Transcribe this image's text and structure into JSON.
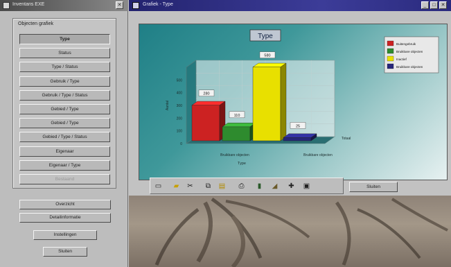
{
  "left_window": {
    "title": "Inventaris EXE"
  },
  "nav": {
    "group_label": "Objecten grafiek",
    "items": [
      {
        "label": "Type",
        "selected": true
      },
      {
        "label": "Status"
      },
      {
        "label": "Type / Status"
      },
      {
        "label": "Gebruik / Type"
      },
      {
        "label": "Gebruik / Type / Status"
      },
      {
        "label": "Gebied / Type"
      },
      {
        "label": "Gebied / Type"
      },
      {
        "label": "Gebied / Type / Status"
      },
      {
        "label": "Eigenaar"
      },
      {
        "label": "Eigenaar / Type"
      },
      {
        "label": "Bestaand",
        "disabled": true
      }
    ]
  },
  "bottom_buttons": {
    "b1": "Overzicht",
    "b2": "Detailinformatie",
    "b3": "Instellingen",
    "b4": "Sluiten"
  },
  "right_window": {
    "title": "Grafiek  -  Type"
  },
  "toolbar_button": "Sluiten",
  "icons": {
    "save": "save-icon",
    "open": "folder-icon",
    "cut": "scissors-icon",
    "copy": "copy-icon",
    "paste": "paste-icon",
    "print": "printer-icon",
    "bar": "bar-chart-icon",
    "area": "area-chart-icon",
    "cross": "crosshair-icon",
    "disk": "disk-icon"
  },
  "chart_data": {
    "type": "bar",
    "title": "Type",
    "categories": [
      "Bruikbare objecten",
      "Bruikbare objecten"
    ],
    "series": [
      {
        "name": "Buitengebruik",
        "color": "#cc2222",
        "values": [
          280,
          null
        ]
      },
      {
        "name": "Bruikbare objecten",
        "color": "#2e8b2e",
        "values": [
          110,
          null
        ]
      },
      {
        "name": "Inactief",
        "color": "#e8e000",
        "values": [
          580,
          null
        ]
      },
      {
        "name": "Bruikbare objecten",
        "color": "#26267a",
        "values": [
          null,
          25
        ]
      }
    ],
    "data_labels": [
      "280",
      "110",
      "580",
      "25"
    ],
    "ylabel": "Aantal",
    "xlabel": "Type",
    "zlabel": "Totaal",
    "yticks": [
      0,
      100,
      200,
      300,
      400,
      500
    ],
    "ylim": [
      0,
      600
    ],
    "legend_placement": "top-right",
    "grid": true,
    "colors": {
      "bg_start": "#1f7f86",
      "bg_end": "#e7f1f1"
    }
  }
}
